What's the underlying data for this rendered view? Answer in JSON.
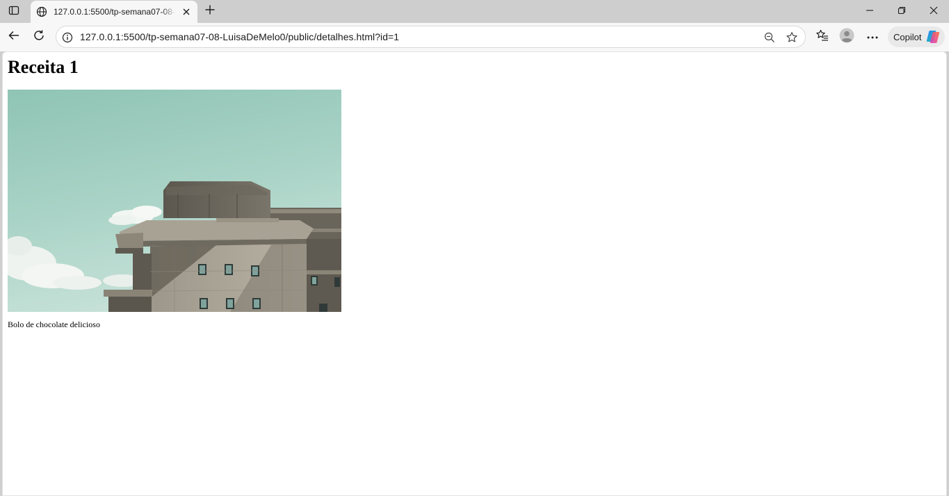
{
  "browser": {
    "tab": {
      "title": "127.0.0.1:5500/tp-semana07-08-LuisaDeMelo0/public/detalhes.html?id=1"
    },
    "address_bar": {
      "url": "127.0.0.1:5500/tp-semana07-08-LuisaDeMelo0/public/detalhes.html?id=1"
    },
    "copilot_label": "Copilot",
    "icons": {
      "tab_actions": "tab-actions-icon",
      "favicon": "globe-icon",
      "tab_close": "close-icon",
      "new_tab": "plus-icon",
      "back": "back-arrow-icon",
      "refresh": "refresh-icon",
      "site_info": "info-icon",
      "zoom": "zoom-out-icon",
      "add_favorite": "star-icon",
      "favorites": "favorites-icon",
      "profile": "profile-icon",
      "more": "more-icon",
      "copilot": "copilot-icon"
    }
  },
  "page": {
    "heading": "Receita 1",
    "image_subject": "concrete bunker building against teal sky",
    "description": "Bolo de chocolate delicioso"
  },
  "colors": {
    "tabstrip_bg": "#cecece",
    "toolbar_bg": "#f7f7f7",
    "page_bg": "#ffffff",
    "text": "#000000"
  }
}
